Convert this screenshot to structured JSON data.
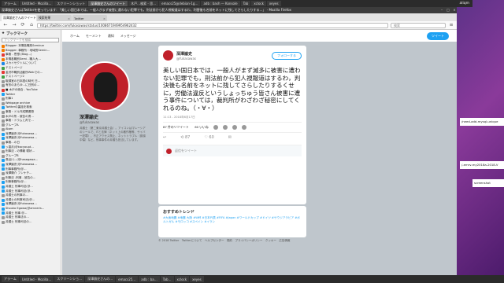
{
  "topbar": {
    "tabs": [
      "アラーム",
      "Untitled - Mozilla...",
      "スクリーンショット",
      "深澤諭史さんのツイート",
      "木戸…検索 - 思…",
      "emacs25@debian-1g…",
      "adb : bash — Konsole",
      "Tab",
      "xclock",
      "xeyes"
    ],
    "clock": "aliqm"
  },
  "firefox": {
    "title": "深澤諭史さんはTwitterを使っています: 「美しい国日本では，一般人がまず被害に遭わない犯罪でも，刑法前から犯人視報道はするわ，利害後も名前をネットに残してさらしたりする…」 - Mozilla Firefox",
    "tabs": [
      "深澤諭史さんのツイート",
      "検索結果",
      "Twitter"
    ],
    "url": "https://twitter.com/fukasawas/status/1008671949954962432",
    "search_placeholder": "検索"
  },
  "sidebar": {
    "title": "ブックマーク",
    "search_placeholder": "ブックマークを検索",
    "items": [
      {
        "label": "Blogger: 本情各職別Seminar",
        "color": "#f57c00"
      },
      {
        "label": "Blogger: 事務所・地域別Semin...",
        "color": "#f57c00"
      },
      {
        "label": "事務 - 思想 (Blog…)",
        "color": "#e53935"
      },
      {
        "label": "本情各職別Semi - 職人大…",
        "color": "#f57c00"
      },
      {
        "label": "スカイセクトルについて",
        "color": "#1e88e5"
      },
      {
        "label": "テストページ",
        "color": "#43a047"
      },
      {
        "label": "金沢市職別活動所Webでの…",
        "color": "#e53935"
      },
      {
        "label": "テストページ2",
        "color": "#43a047"
      },
      {
        "label": "取調室の日本語の時代 日…",
        "color": "#999999"
      },
      {
        "label": "有形のあらゆ…に日別の…",
        "color": "#999999"
      },
      {
        "label": "■ 木戸の総合 - YouTube",
        "color": "#e53935"
      },
      {
        "label": "Twitter",
        "color": "#1da1f2"
      },
      {
        "label": "刑事1",
        "color": "#999999"
      },
      {
        "label": "Webpage archive",
        "color": "#999999"
      },
      {
        "label": "Twitterの裏話を検索",
        "color": "#1da1f2"
      },
      {
        "label": "事務・ドル作成関連物",
        "color": "#999999"
      },
      {
        "label": "木戸の所 - 被告の書…",
        "color": "#999999"
      },
      {
        "label": "事務・ドラムと判で…",
        "color": "#999999"
      },
      {
        "label": "グループA",
        "color": "#999999"
      },
      {
        "label": "Atom",
        "color": "#999999"
      },
      {
        "label": "深澤諭史(@fukasawa…",
        "color": "#1da1f2"
      },
      {
        "label": "深澤諭史(@fukasawa…",
        "color": "#1da1f2"
      },
      {
        "label": "事務…の日",
        "color": "#999999"
      },
      {
        "label": "ッ香月(@kacyoupt…",
        "color": "#1da1f2"
      },
      {
        "label": "刑事法 - の情報 現状…",
        "color": "#999999"
      },
      {
        "label": "グループB",
        "color": "#999999"
      },
      {
        "label": "長谷川…(@hasegawa…",
        "color": "#1da1f2"
      },
      {
        "label": "深澤諭史(@fukasawa…",
        "color": "#1da1f2"
      },
      {
        "label": "刑事事務所(@…",
        "color": "#1da1f2"
      },
      {
        "label": "深澤陽介 フンケチ…",
        "color": "#999999"
      },
      {
        "label": "刑事法 -刑事 - 被告の…",
        "color": "#999999"
      },
      {
        "label": "刑事事務所(@…",
        "color": "#1da1f2"
      },
      {
        "label": "弁護士 刑事司法(@…",
        "color": "#1da1f2"
      },
      {
        "label": "弁護士 刑事司法(@…",
        "color": "#1da1f2"
      },
      {
        "label": "弁護士の刑事の…",
        "color": "#999999"
      },
      {
        "label": "弁護士の刑事司法(@…",
        "color": "#1da1f2"
      },
      {
        "label": "深澤諭史(@fukasawa…",
        "color": "#1da1f2"
      },
      {
        "label": "Shouko Egawa(@amneris…",
        "color": "#1da1f2"
      },
      {
        "label": "弁護士 刑事 @…",
        "color": "#1da1f2"
      },
      {
        "label": "弁護士 刑事法の…",
        "color": "#999999"
      },
      {
        "label": "弁護士 刑事司法の…",
        "color": "#999999"
      }
    ]
  },
  "twitter": {
    "nav": [
      "ホーム",
      "モーメント",
      "通知",
      "メッセージ"
    ],
    "tweet_button": "ツイート",
    "profile": {
      "name": "深澤諭史",
      "handle": "@fukasawas",
      "bio": "弁護士（第二東京弁護士会）。アイコンはマレーシアのシールで、ITと法律（ネット上の著作権等、サイバー犯罪）、不正アクセス禁止、ネットトラブル（誹謗中傷）など。刑事事件の弁護も担当しています。"
    },
    "tweet": {
      "name": "深澤諭史",
      "handle": "@fukasawas",
      "follow_label": "フォローする",
      "text": "美しい国日本では，一般人がまず滅多に被害に遭わない犯罪でも，刑法前から犯人視報道はするわ，判決後も名前をネットに残してさらしたりするくせに，労働法違反というしょっちゅう皆さん被害に遭う事件については，裁判所がわざわざ秘密にしてくれるのね。（・∀・）",
      "time": "11:13 - 2018年6月17日",
      "stats": "87 件のリツイート　　60 いいね",
      "actions": [
        "↩",
        "⟲ 87",
        "♡ 60",
        "✉"
      ],
      "reply_placeholder": "返信をツイート"
    },
    "trends": {
      "title": "おすすめトレンド",
      "items": "#大坂地震 #地震 大阪 #W杯 #日本代表 #FIFA #Japan #ワールドカップ #ドイツ #サウジアラビア #ポルトガル #モロッコ #スペイン #イラン"
    },
    "footer": "© 2018 Twitter　Twitterについて　ヘルプセンター　規約　プライバシーポリシー　クッキー　広告情報"
  },
  "widgets": {
    "w1": "/need-add-mysql-unique",
    "w2": "/-emrv-my2018a-2018-V",
    "w3": "screenshot"
  },
  "dock": [
    "アラーム",
    "Untitled - Mozilla...",
    "スクリーンショ…",
    "深澤諭史さんの…",
    "emacs25…",
    "adb : ba…",
    "Tab…",
    "xclock",
    "xeyes"
  ]
}
